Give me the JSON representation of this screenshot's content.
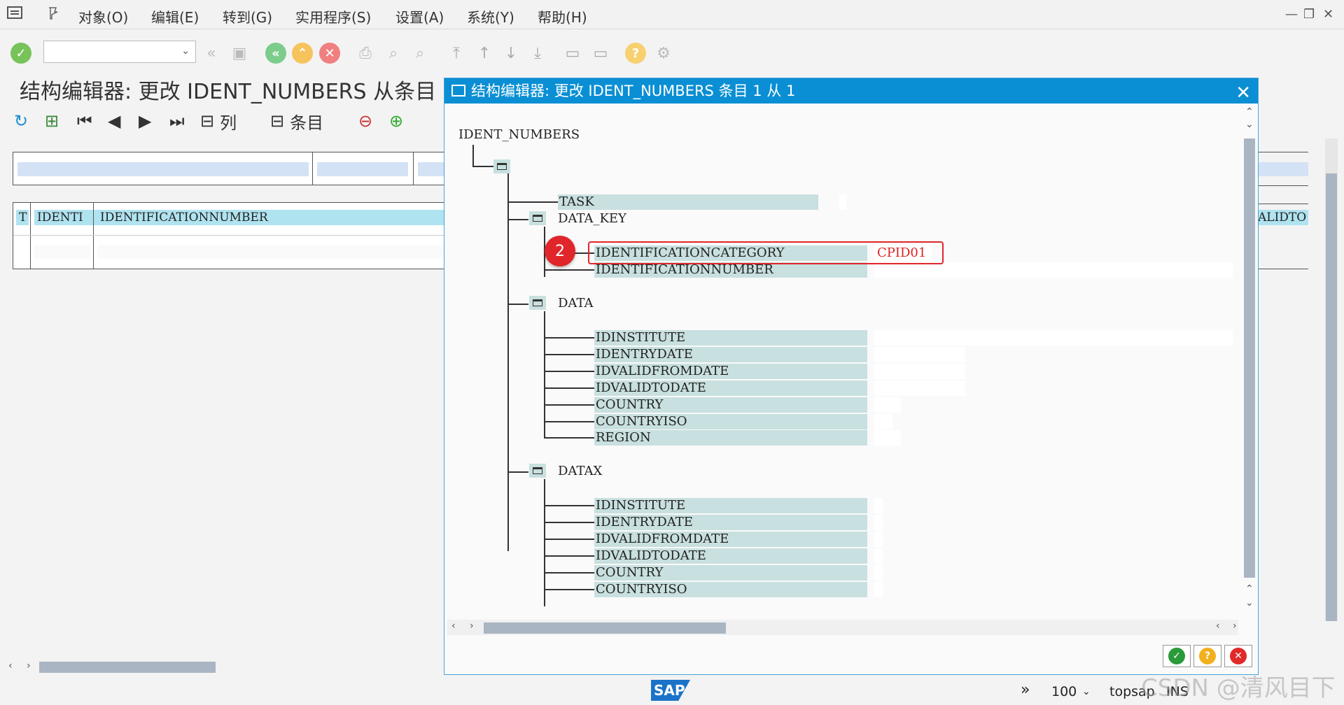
{
  "menu": {
    "items": [
      "对象(O)",
      "编辑(E)",
      "转到(G)",
      "实用程序(S)",
      "设置(A)",
      "系统(Y)",
      "帮助(H)"
    ]
  },
  "main": {
    "title": "结构编辑器: 更改 IDENT_NUMBERS 从条目",
    "toolbar_col_label": "列",
    "toolbar_entry_label": "条目",
    "header_t": "T",
    "header_identi": "IDENTI",
    "header_idnum": "IDENTIFICATIONNUMBER",
    "header_right": "ALIDTO"
  },
  "dialog": {
    "title": "结构编辑器: 更改 IDENT_NUMBERS 条目 1 从 1",
    "root": "IDENT_NUMBERS",
    "task": "TASK",
    "data_key": "DATA_KEY",
    "data_key_fields": [
      "IDENTIFICATIONCATEGORY",
      "IDENTIFICATIONNUMBER"
    ],
    "category_value": "CPID01",
    "data": "DATA",
    "data_fields": [
      "IDINSTITUTE",
      "IDENTRYDATE",
      "IDVALIDFROMDATE",
      "IDVALIDTODATE",
      "COUNTRY",
      "COUNTRYISO",
      "REGION"
    ],
    "datax": "DATAX",
    "datax_fields": [
      "IDINSTITUTE",
      "IDENTRYDATE",
      "IDVALIDFROMDATE",
      "IDVALIDTODATE",
      "COUNTRY",
      "COUNTRYISO"
    ]
  },
  "annotation": {
    "badge": "2"
  },
  "status": {
    "zoom": "100",
    "server": "topsap",
    "mode": "INS",
    "logo": "SAP"
  },
  "watermark": "CSDN @清风目下",
  "colors": {
    "title_bar": "#0a8fd4",
    "field_bg": "#c8e0df",
    "highlight": "#e0262a",
    "header_cell": "#b0e3f0"
  }
}
